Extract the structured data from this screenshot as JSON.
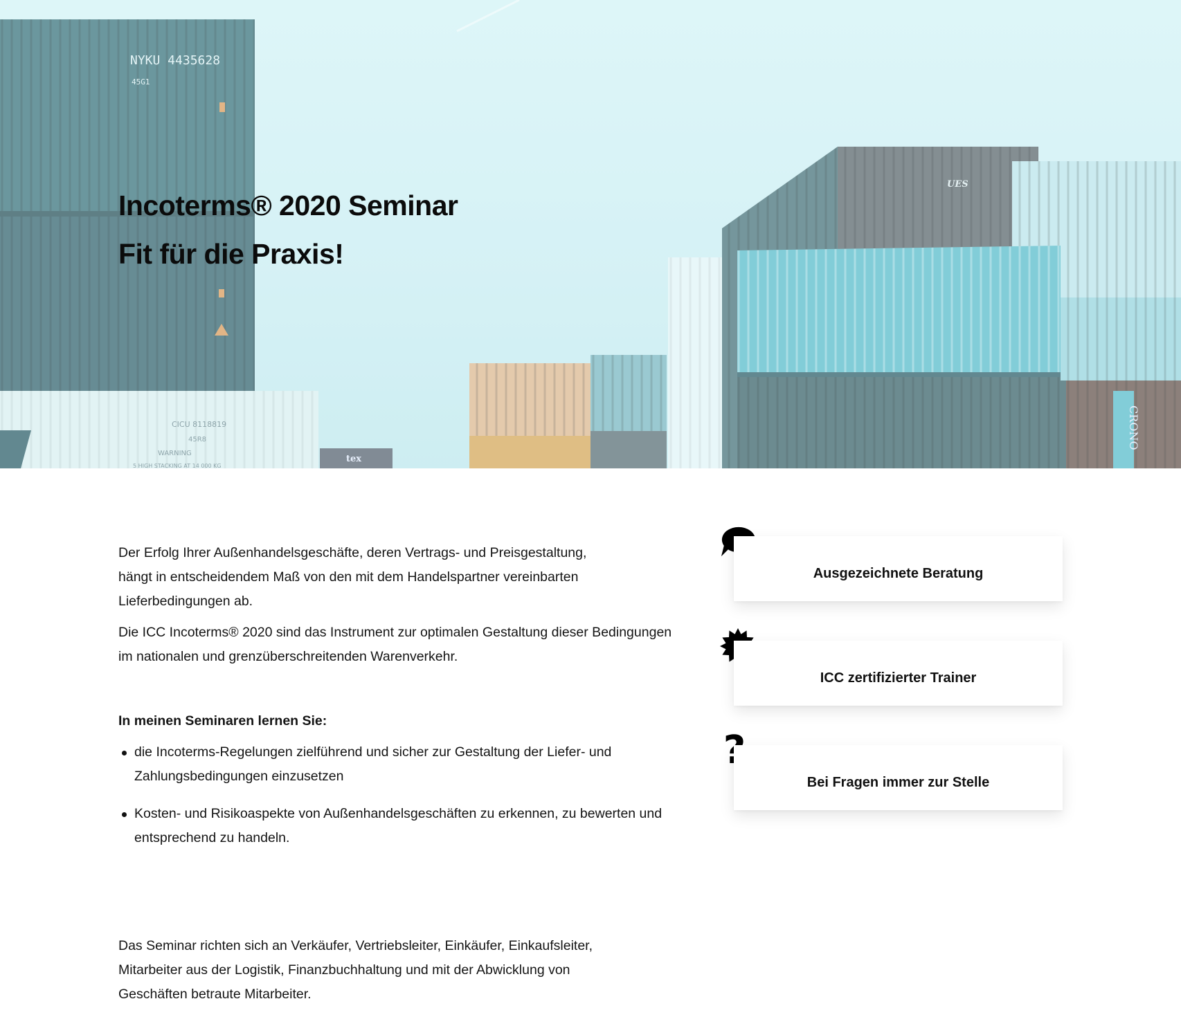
{
  "hero": {
    "title_line1": "Incoterms® 2020 Seminar",
    "title_line2": "Fit für die Praxis!",
    "container_labels": {
      "nyku": "NYKU 4435628",
      "nyku_sub": "45G1",
      "cicu": "CICU 8118819",
      "cicu_sub": "45R8",
      "warning": "WARNING",
      "stacking": "5 HIGH STACKING AT 14 000 KG",
      "tex": "tex",
      "ues": "UES",
      "crono": "CRONO"
    }
  },
  "intro": {
    "p1": "Der Erfolg Ihrer Außenhandelsgeschäfte, deren Vertrags- und Preisgestaltung, hängt in entscheidendem Maß von den mit dem Handelspartner vereinbarten Lieferbedingungen ab.",
    "p2": "Die ICC Incoterms® 2020 sind das Instrument zur optimalen Gestaltung dieser Bedingungen im nationalen und grenzüberschreitenden Warenverkehr."
  },
  "learn": {
    "heading": "In meinen Seminaren lernen Sie:",
    "items": [
      "die Incoterms-Regelungen zielführend und sicher zur Gestaltung der Liefer- und Zahlungsbedingungen einzusetzen",
      "Kosten- und Risikoaspekte von Außenhandelsgeschäften zu erkennen, zu bewerten und entsprechend zu handeln."
    ]
  },
  "features": [
    {
      "icon": "speech-bubble-icon",
      "label": "Ausgezeichnete Beratung"
    },
    {
      "icon": "badge-icon",
      "label": "ICC zertifizierter Trainer"
    },
    {
      "icon": "question-mark-icon",
      "glyph": "?",
      "label": "Bei Fragen immer zur Stelle"
    }
  ],
  "audience": {
    "text": "Das Seminar richten sich an Verkäufer, Vertriebsleiter, Einkäufer, Einkaufsleiter, Mitarbeiter aus der Logistik, Finanzbuchhaltung und mit der Abwicklung von Geschäften betraute Mitarbeiter."
  },
  "colors": {
    "sky": "#dff6f8",
    "container_dark": "#2f5a63",
    "container_teal": "#5fbcc7",
    "container_orange": "#e7b98d",
    "text": "#111111"
  }
}
